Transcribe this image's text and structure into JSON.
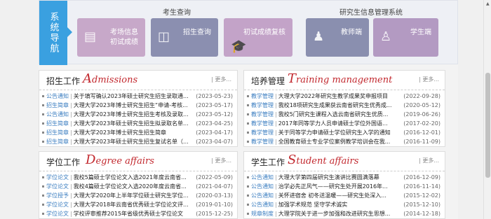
{
  "nav": {
    "label": "系统导航",
    "exam_group_title": "考生查询",
    "info_group_title": "研究生信息管理系统",
    "tiles": [
      {
        "line1": "考场信息",
        "line2": "初试成绩",
        "icon": "document-icon"
      },
      {
        "line1": "招生查询",
        "line2": "",
        "icon": "monitor-icon"
      },
      {
        "line1": "初试成绩复核",
        "line2": "",
        "icon": "graduation-cap-icon"
      },
      {
        "line1": "教师端",
        "line2": "",
        "icon": "teacher-icon"
      },
      {
        "line1": "学生端",
        "line2": "",
        "icon": "student-icon"
      }
    ]
  },
  "admissions": {
    "title": "招生工作",
    "script_cap": "A",
    "script_rest": "dmissions",
    "more": "| 更多...",
    "rows": [
      {
        "cat": "公告通知",
        "title": "关于填写确认2023年硕士研究生招生录取通...",
        "date": "(2023-05-23)"
      },
      {
        "cat": "招生简章",
        "title": "大理大学2023年博士研究生招生“申请-考核...",
        "date": "(2023-05-17)"
      },
      {
        "cat": "公告通知",
        "title": "大理大学2023年博士研究生招生考核及录取...",
        "date": "(2023-05-12)"
      },
      {
        "cat": "招生简章",
        "title": "大理大学2023年硕士研究生招生拟录取名单...",
        "date": "(2023-04-25)"
      },
      {
        "cat": "招生简章",
        "title": "大理大学2023年博士研究生招生简章",
        "date": "(2023-04-17)"
      },
      {
        "cat": "招生简章",
        "title": "大理大学2023年硕士研究生招生复试名单（...",
        "date": "(2023-04-07)"
      }
    ]
  },
  "training": {
    "title": "培养管理",
    "script_cap": "T",
    "script_rest": "raining management",
    "more": "| 更多...",
    "rows": [
      {
        "cat": "教学管理",
        "title": "大理大学2022年研究生教学成果奖申报项目",
        "date": "(2022-09-28)"
      },
      {
        "cat": "教学管理",
        "title": "我校18项研究生成果获云南省研究生优秀成...",
        "date": "(2020-05-12)"
      },
      {
        "cat": "教学管理",
        "title": "我校5门研究生课程入选云南省研究生优质...",
        "date": "(2019-06-26)"
      },
      {
        "cat": "教学管理",
        "title": "2017年同等学力人员申请硕士学位外国语...",
        "date": "(2017-02-20)"
      },
      {
        "cat": "教学管理",
        "title": "关于同等学力申请硕士学位研究生入学的通知",
        "date": "(2016-12-01)"
      },
      {
        "cat": "教学管理",
        "title": "全国教育硕士专业学位案例教学培训会在我...",
        "date": "(2016-11-09)"
      }
    ]
  },
  "degree": {
    "title": "学位工作",
    "script_cap": "D",
    "script_rest": "egree affairs",
    "more": "| 更多...",
    "rows": [
      {
        "cat": "学位论文",
        "title": "我校5篇硕士学位论文入选2021年度云南省...",
        "date": "(2022-05-09)"
      },
      {
        "cat": "学位论文",
        "title": "我校4篇硕士学位论文入选2020年度云南省...",
        "date": "(2021-04-07)"
      },
      {
        "cat": "学位授予",
        "title": "大理大学2020年上半年学位硕士研究生学位...",
        "date": "(2020-03-13)"
      },
      {
        "cat": "学位论文",
        "title": "大理大学2018年云南省优秀硕士学位论文评...",
        "date": "(2019-01-10)"
      },
      {
        "cat": "学位论文",
        "title": "学校评审推荐2015年省级优秀硕士学位论文",
        "date": "(2015-12-25)"
      }
    ]
  },
  "student": {
    "title": "学生工作",
    "script_cap": "S",
    "script_rest": "tudent affairs",
    "more": "| 更多...",
    "rows": [
      {
        "cat": "公告通知",
        "title": "大理大学第四届研究生演讲比赛圆满落幕",
        "date": "(2016-12-09)"
      },
      {
        "cat": "公告通知",
        "title": "治学必先正风气——研究生处开展2016年...",
        "date": "(2016-11-14)"
      },
      {
        "cat": "公告通知",
        "title": "关怀进宿舍 初冬送温暖——研究生处深入...",
        "date": "(2015-12-02)"
      },
      {
        "cat": "公告通知",
        "title": "加强学术规范 坚守学术诚实",
        "date": "(2015-12-10)"
      },
      {
        "cat": "规章制度",
        "title": "大理学院关于进一步加强和改进研究生思想...",
        "date": "(2014-12-18)"
      }
    ]
  }
}
